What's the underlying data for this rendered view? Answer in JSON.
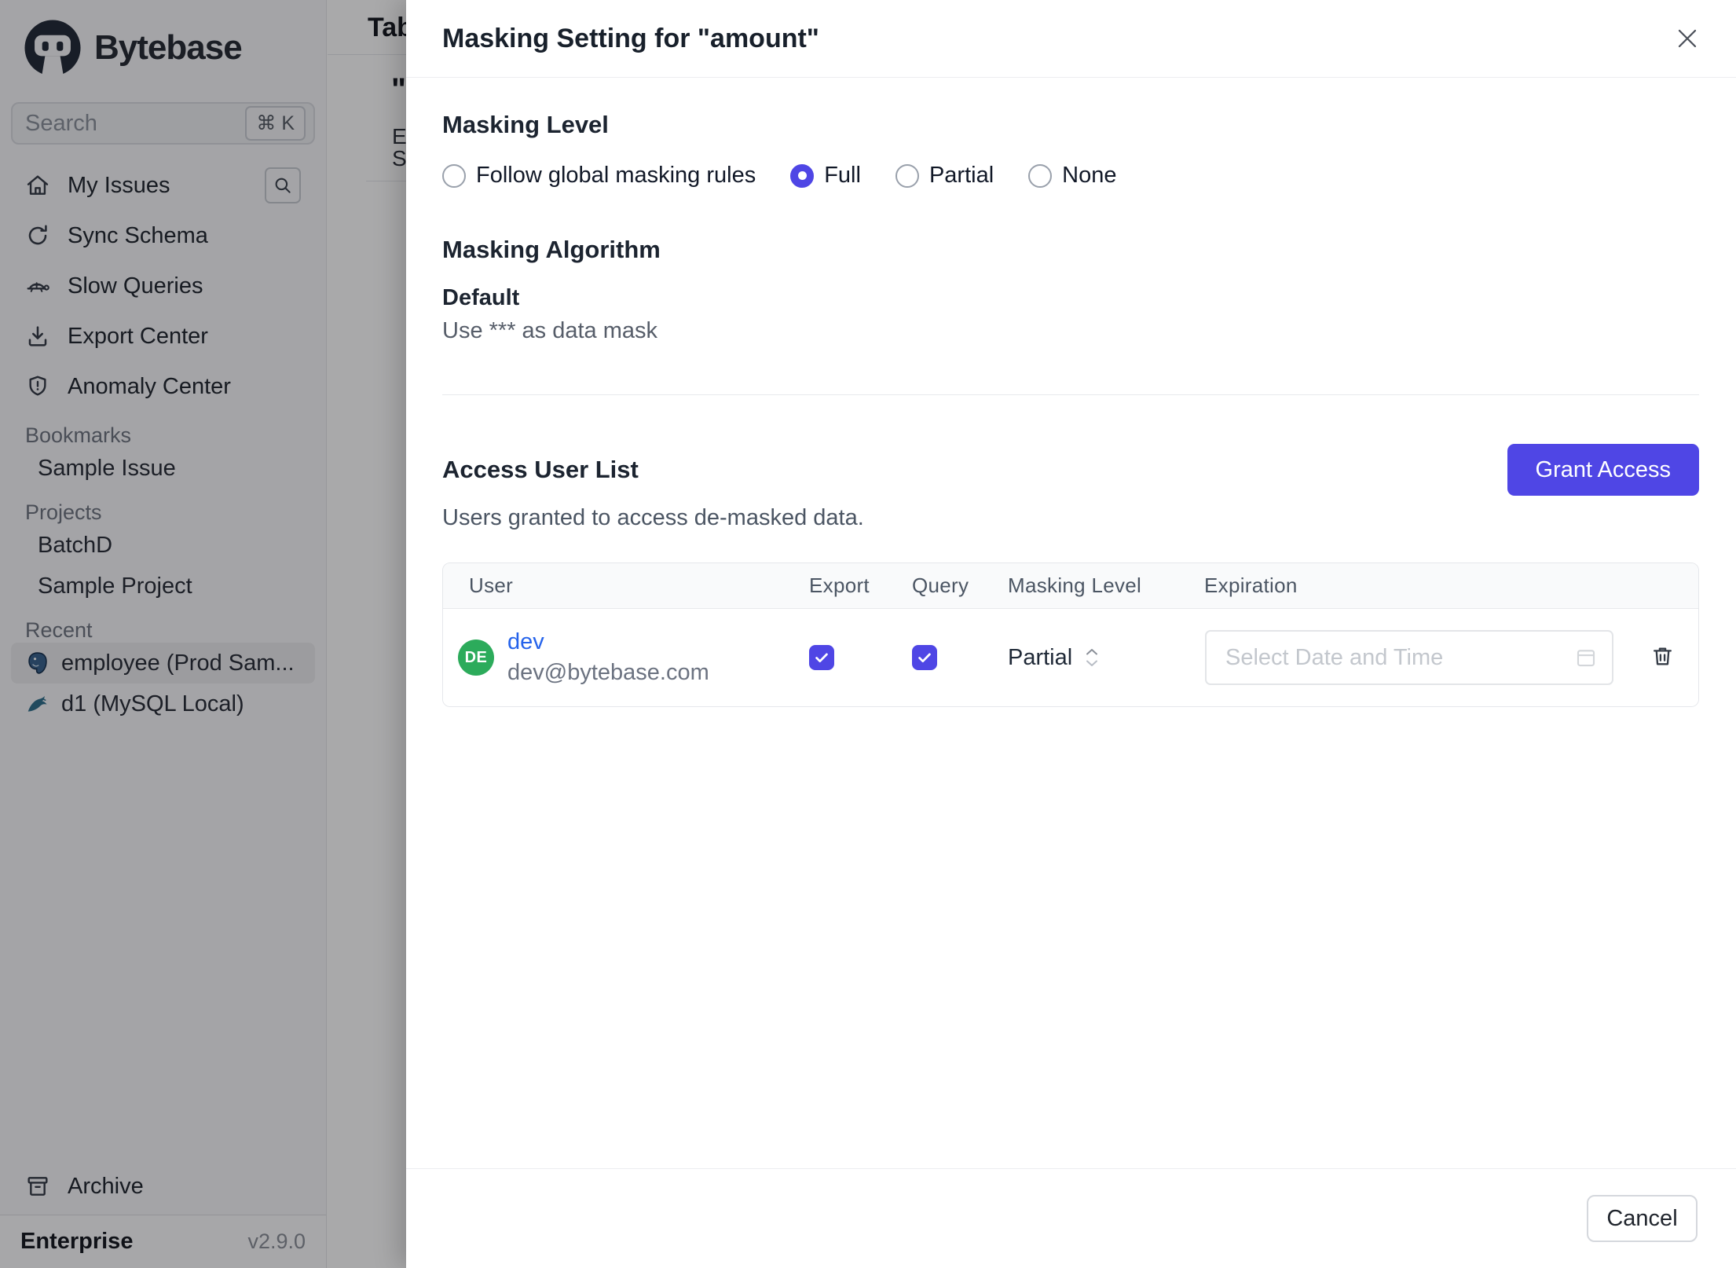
{
  "colors": {
    "accent": "#4f46e5",
    "link_blue": "#2563eb",
    "avatar_green": "#2cab5b",
    "postgres_blue": "#38618c",
    "mysql_teal": "#2d6d8a"
  },
  "sidebar": {
    "logo_text": "Bytebase",
    "search": {
      "placeholder": "Search",
      "shortcut": "⌘ K"
    },
    "nav": [
      {
        "label": "My Issues",
        "icon": "home-icon"
      },
      {
        "label": "Sync Schema",
        "icon": "sync-icon"
      },
      {
        "label": "Slow Queries",
        "icon": "turtle-icon"
      },
      {
        "label": "Export Center",
        "icon": "download-icon"
      },
      {
        "label": "Anomaly Center",
        "icon": "shield-icon"
      }
    ],
    "sections": [
      {
        "label": "Bookmarks",
        "items": [
          {
            "label": "Sample Issue"
          }
        ]
      },
      {
        "label": "Projects",
        "items": [
          {
            "label": "BatchD"
          },
          {
            "label": "Sample Project"
          }
        ]
      },
      {
        "label": "Recent",
        "items": [
          {
            "label": "employee (Prod Sam...",
            "icon": "postgres-icon",
            "selected": true
          },
          {
            "label": "d1 (MySQL Local)",
            "icon": "mysql-icon",
            "selected": false
          }
        ]
      }
    ],
    "archive_label": "Archive",
    "plan": "Enterprise",
    "version": "v2.9.0"
  },
  "background_page": {
    "partials": [
      "Tab",
      "\"",
      "E",
      "S"
    ]
  },
  "modal": {
    "title": "Masking Setting for \"amount\"",
    "masking_level": {
      "heading": "Masking Level",
      "options": [
        {
          "label": "Follow global masking rules",
          "selected": false
        },
        {
          "label": "Full",
          "selected": true
        },
        {
          "label": "Partial",
          "selected": false
        },
        {
          "label": "None",
          "selected": false
        }
      ]
    },
    "masking_algorithm": {
      "heading": "Masking Algorithm",
      "name": "Default",
      "description": "Use *** as data mask"
    },
    "access": {
      "heading": "Access User List",
      "subtitle": "Users granted to access de-masked data.",
      "grant_button": "Grant Access",
      "table": {
        "columns": [
          "User",
          "Export",
          "Query",
          "Masking Level",
          "Expiration"
        ],
        "rows": [
          {
            "user_name": "dev",
            "user_email": "dev@bytebase.com",
            "avatar_initials": "DE",
            "export_checked": true,
            "query_checked": true,
            "masking_level": "Partial",
            "expiration_placeholder": "Select Date and Time"
          }
        ]
      }
    },
    "footer": {
      "cancel_label": "Cancel"
    }
  }
}
